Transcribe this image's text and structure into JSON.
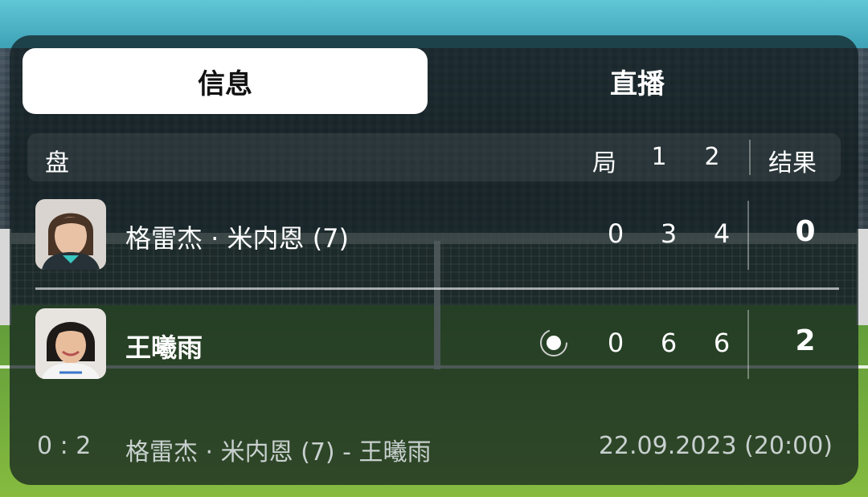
{
  "tabs": [
    {
      "label": "信息",
      "active": true
    },
    {
      "label": "直播",
      "active": false
    }
  ],
  "table_header": {
    "label": "盘",
    "games": "局",
    "set1": "1",
    "set2": "2",
    "result": "结果"
  },
  "players": [
    {
      "name": "格雷杰 · 米内恩 (7)",
      "games": "0",
      "set1": "3",
      "set2": "4",
      "result": "0",
      "serving": false,
      "winner": false
    },
    {
      "name": "王曦雨",
      "games": "0",
      "set1": "6",
      "set2": "6",
      "result": "2",
      "serving": true,
      "winner": true
    }
  ],
  "footer": {
    "total": "0 : 2",
    "match": "格雷杰 · 米内恩 (7) - 王曦雨",
    "date": "22.09.2023 (20:00)"
  },
  "colors": {
    "accent_bg": "#0f1c1e",
    "text": "#ffffff",
    "muted": "#c8d0cf"
  },
  "icons": {
    "avatar_1": "player-photo",
    "avatar_2": "player-photo",
    "serve": "serving-indicator-icon"
  }
}
